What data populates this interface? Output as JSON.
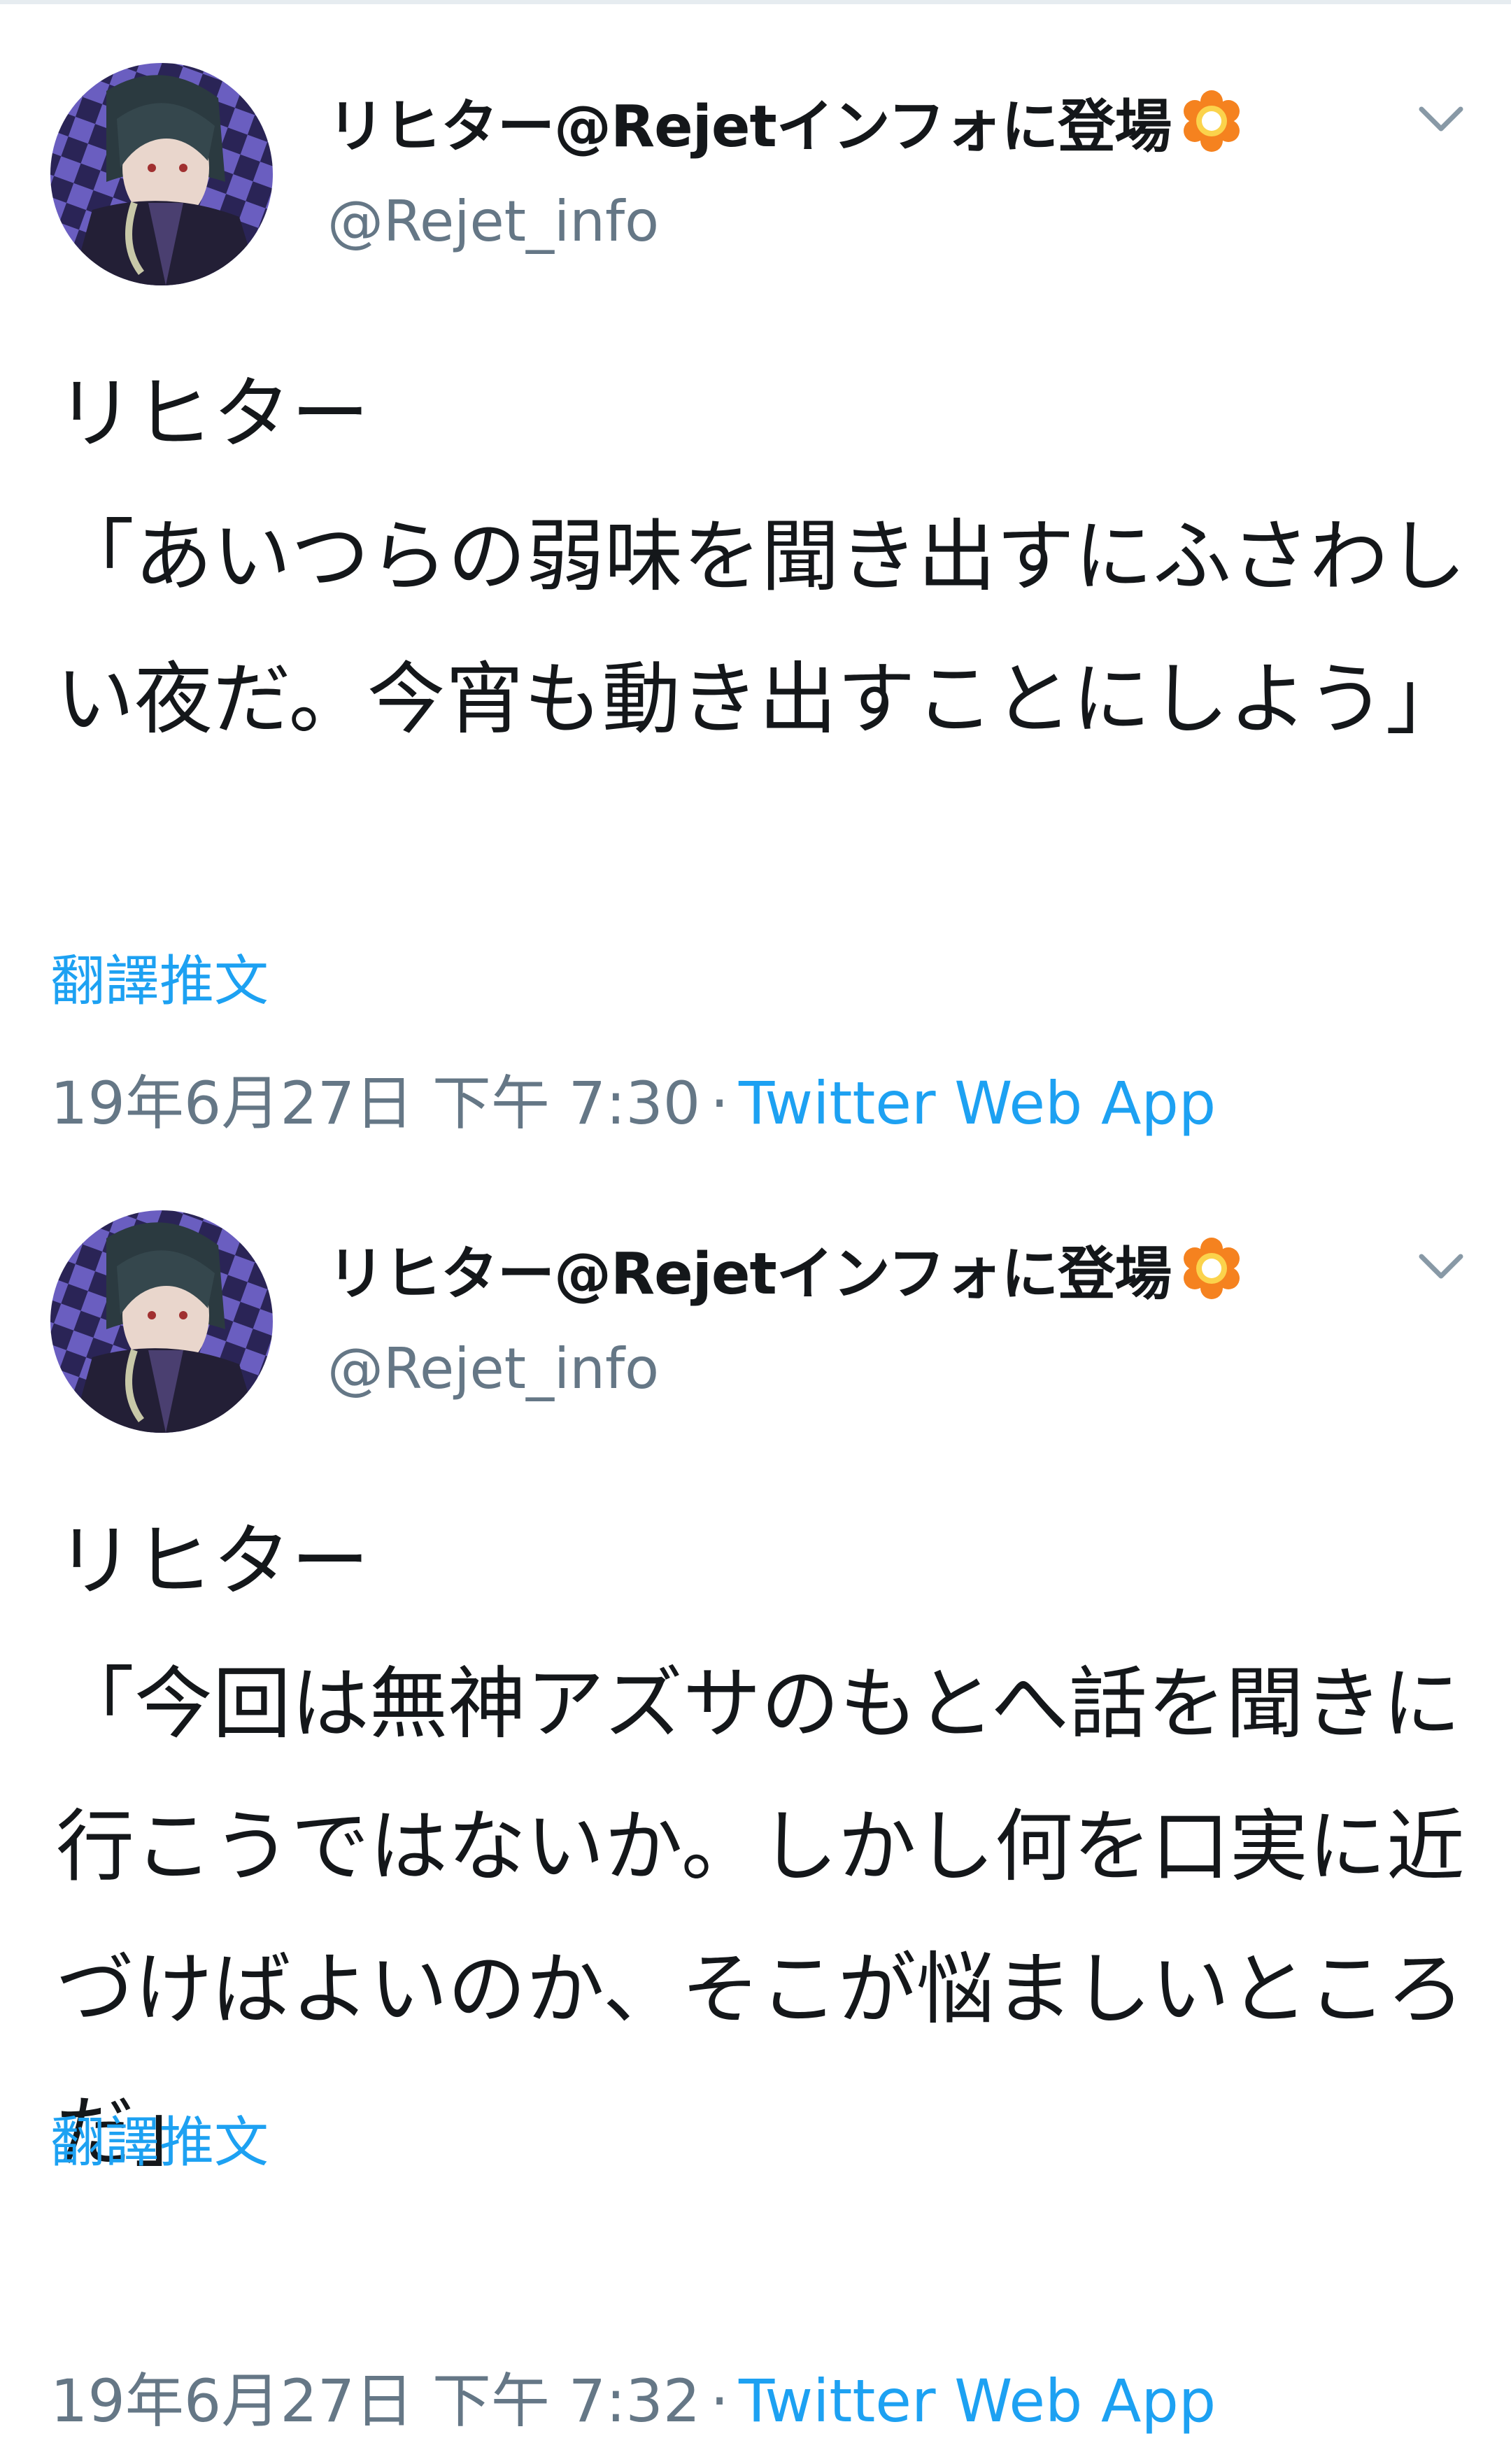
{
  "tweets": [
    {
      "author": {
        "display_name": "リヒター@Rejetインフォに登場",
        "handle": "@Rejet_info",
        "badge_icon": "orange-flower-icon",
        "avatar_icon": "anime-character-avatar"
      },
      "menu_icon": "chevron-down-icon",
      "text": "リヒター\n「あいつらの弱味を聞き出すにふさわしい夜だ。今宵も動き出すことにしよう」",
      "translate_label": "翻譯推文",
      "timestamp": "19年6月27日 下午 7:30",
      "separator": "·",
      "source": "Twitter Web App"
    },
    {
      "author": {
        "display_name": "リヒター@Rejetインフォに登場",
        "handle": "@Rejet_info",
        "badge_icon": "orange-flower-icon",
        "avatar_icon": "anime-character-avatar"
      },
      "menu_icon": "chevron-down-icon",
      "text": "リヒター\n「今回は無神アズサのもとへ話を聞きに行こうではないか。しかし何を口実に近づけばよいのか、そこが悩ましいところだ」",
      "translate_label": "翻譯推文",
      "timestamp": "19年6月27日 下午 7:32",
      "separator": "·",
      "source": "Twitter Web App"
    }
  ],
  "colors": {
    "text": "#14171a",
    "secondary": "#657786",
    "link": "#1da1f2",
    "badge": "#f5821f"
  }
}
